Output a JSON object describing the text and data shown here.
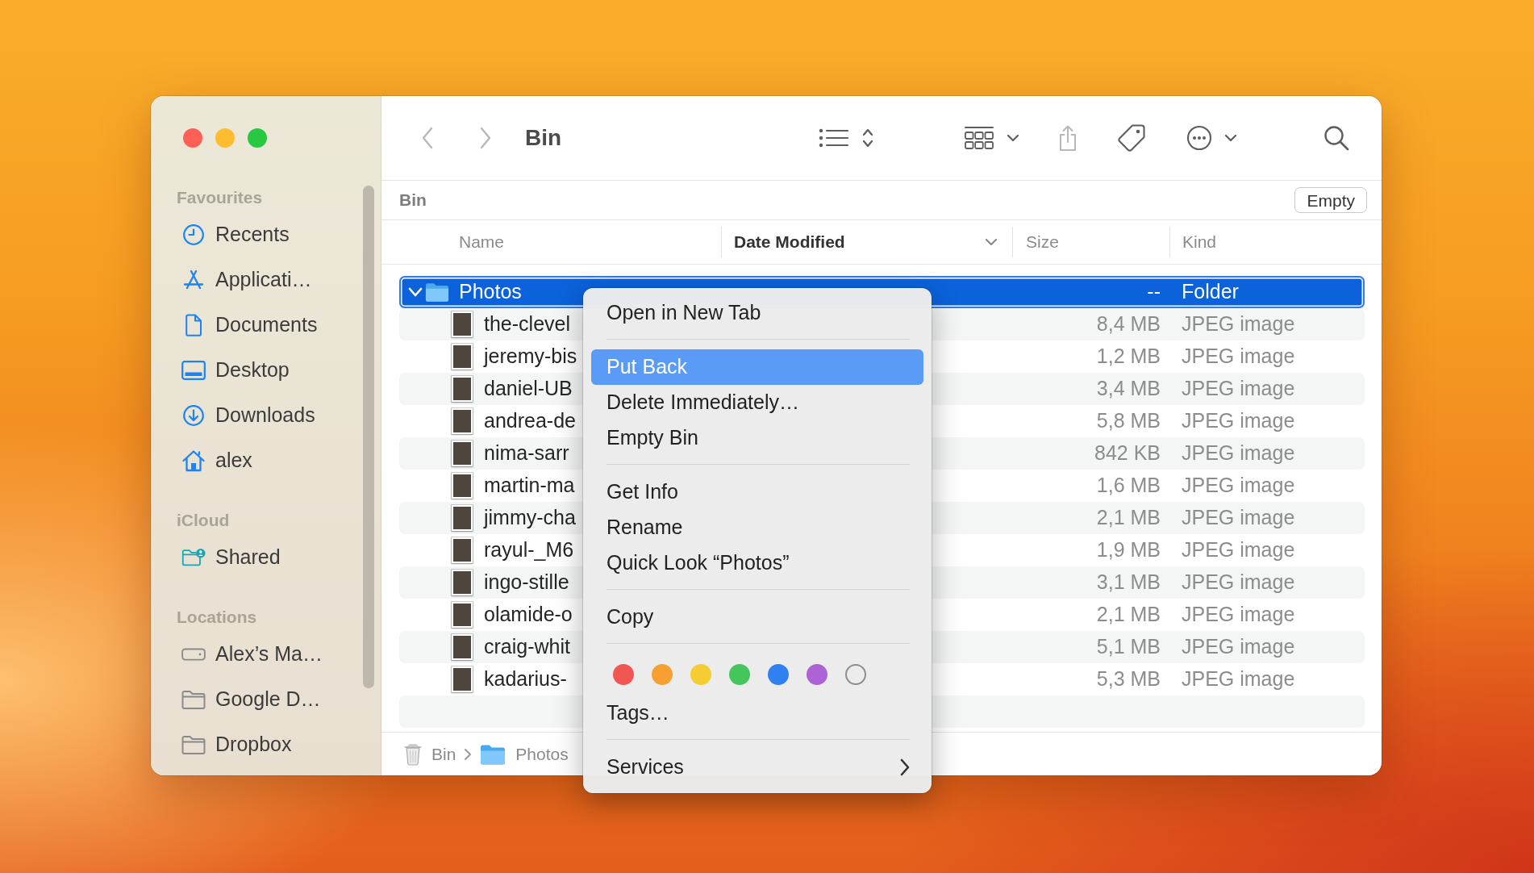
{
  "sidebar": {
    "sections": [
      {
        "title": "Favourites",
        "items": [
          {
            "label": "Recents",
            "kind": "recents",
            "selected": false
          },
          {
            "label": "Applicati…",
            "kind": "applications",
            "selected": false
          },
          {
            "label": "Documents",
            "kind": "documents",
            "selected": false
          },
          {
            "label": "Desktop",
            "kind": "desktop",
            "selected": false
          },
          {
            "label": "Downloads",
            "kind": "downloads",
            "selected": false
          },
          {
            "label": "alex",
            "kind": "home",
            "selected": false
          }
        ]
      },
      {
        "title": "iCloud",
        "items": [
          {
            "label": "Shared",
            "kind": "shared",
            "selected": false
          }
        ]
      },
      {
        "title": "Locations",
        "items": [
          {
            "label": "Alex’s Ma…",
            "kind": "disk",
            "selected": false
          },
          {
            "label": "Google D…",
            "kind": "folder",
            "selected": false
          },
          {
            "label": "Dropbox",
            "kind": "folder",
            "selected": false
          }
        ]
      }
    ]
  },
  "toolbar": {
    "navigation": [
      {
        "kind": "back",
        "disabled": true
      },
      {
        "kind": "forward",
        "disabled": true
      }
    ],
    "title": "Bin",
    "actions": [
      {
        "kind": "view",
        "disabled": false
      },
      {
        "kind": "group",
        "disabled": false
      },
      {
        "kind": "share",
        "disabled": true
      },
      {
        "kind": "tags",
        "disabled": false
      },
      {
        "kind": "more",
        "disabled": false
      },
      {
        "kind": "search",
        "disabled": false
      }
    ]
  },
  "location_bar": {
    "title": "Bin",
    "button": "Empty"
  },
  "table": {
    "columns": [
      {
        "label": "Name",
        "sorted": false
      },
      {
        "label": "Date Modified",
        "sorted": true
      },
      {
        "label": "Size",
        "sorted": false
      },
      {
        "label": "Kind",
        "sorted": false
      }
    ],
    "rows": [
      {
        "name": "Photos",
        "size": "--",
        "file_kind": "Folder",
        "selected": true,
        "expanded": true,
        "children": [
          {
            "name": "the-clevel",
            "size": "8,4 MB",
            "file_kind": "JPEG image",
            "selected": false
          },
          {
            "name": "jeremy-bis",
            "size": "1,2 MB",
            "file_kind": "JPEG image",
            "selected": false
          },
          {
            "name": "daniel-UB",
            "size": "3,4 MB",
            "file_kind": "JPEG image",
            "selected": false
          },
          {
            "name": "andrea-de",
            "size": "5,8 MB",
            "file_kind": "JPEG image",
            "selected": false
          },
          {
            "name": "nima-sarr",
            "size": "842 KB",
            "file_kind": "JPEG image",
            "selected": false
          },
          {
            "name": "martin-ma",
            "size": "1,6 MB",
            "file_kind": "JPEG image",
            "selected": false
          },
          {
            "name": "jimmy-cha",
            "size": "2,1 MB",
            "file_kind": "JPEG image",
            "selected": false
          },
          {
            "name": "rayul-_M6",
            "size": "1,9 MB",
            "file_kind": "JPEG image",
            "selected": false
          },
          {
            "name": "ingo-stille",
            "size": "3,1 MB",
            "file_kind": "JPEG image",
            "selected": false
          },
          {
            "name": "olamide-o",
            "size": "2,1 MB",
            "file_kind": "JPEG image",
            "selected": false
          },
          {
            "name": "craig-whit",
            "size": "5,1 MB",
            "file_kind": "JPEG image",
            "selected": false
          },
          {
            "name": "kadarius-",
            "size": "5,3 MB",
            "file_kind": "JPEG image",
            "selected": false
          }
        ]
      }
    ]
  },
  "path_bar": [
    {
      "label": "Bin",
      "kind": "bin"
    },
    {
      "label": "Photos",
      "kind": "folder"
    }
  ],
  "context_menu": {
    "items": [
      {
        "kind": "item",
        "label": "Open in New Tab",
        "selected": false
      },
      {
        "kind": "separator"
      },
      {
        "kind": "item",
        "label": "Put Back",
        "selected": true
      },
      {
        "kind": "item",
        "label": "Delete Immediately…",
        "selected": false
      },
      {
        "kind": "item",
        "label": "Empty Bin",
        "selected": false
      },
      {
        "kind": "separator"
      },
      {
        "kind": "item",
        "label": "Get Info",
        "selected": false
      },
      {
        "kind": "item",
        "label": "Rename",
        "selected": false
      },
      {
        "kind": "item",
        "label": "Quick Look “Photos”",
        "selected": false
      },
      {
        "kind": "separator"
      },
      {
        "kind": "item",
        "label": "Copy",
        "selected": false
      },
      {
        "kind": "separator"
      },
      {
        "kind": "tags",
        "tags": [
          {
            "kind": "filled",
            "color": "#f25653"
          },
          {
            "kind": "filled",
            "color": "#f6a032"
          },
          {
            "kind": "filled",
            "color": "#f5cd32"
          },
          {
            "kind": "filled",
            "color": "#44c65a"
          },
          {
            "kind": "filled",
            "color": "#2f80f0"
          },
          {
            "kind": "filled",
            "color": "#ad62d6"
          },
          {
            "kind": "outline",
            "color": "#8e8e8e"
          }
        ]
      },
      {
        "kind": "item",
        "label": "Tags…",
        "selected": false
      },
      {
        "kind": "separator"
      },
      {
        "kind": "submenu",
        "label": "Services",
        "selected": false
      }
    ]
  }
}
